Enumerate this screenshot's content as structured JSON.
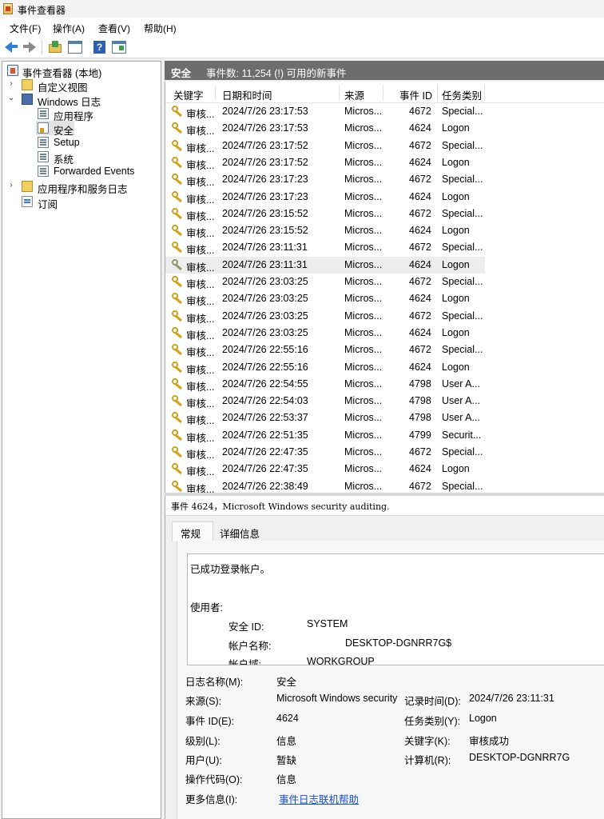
{
  "window": {
    "title": "事件查看器"
  },
  "menu": [
    "文件(F)",
    "操作(A)",
    "查看(V)",
    "帮助(H)"
  ],
  "tree": {
    "root": "事件查看器 (本地)",
    "custom_views": "自定义视图",
    "windows_logs": "Windows 日志",
    "logs": [
      "应用程序",
      "安全",
      "Setup",
      "系统",
      "Forwarded Events"
    ],
    "app_service_logs": "应用程序和服务日志",
    "subscriptions": "订阅"
  },
  "pane": {
    "title": "安全",
    "count_text": "事件数: 11,254 (!) 可用的新事件"
  },
  "columns": [
    "关键字",
    "日期和时间",
    "来源",
    "事件 ID",
    "任务类别"
  ],
  "rows": [
    [
      "审核...",
      "2024/7/26 23:17:53",
      "Micros...",
      "4672",
      "Special..."
    ],
    [
      "审核...",
      "2024/7/26 23:17:53",
      "Micros...",
      "4624",
      "Logon"
    ],
    [
      "审核...",
      "2024/7/26 23:17:52",
      "Micros...",
      "4672",
      "Special..."
    ],
    [
      "审核...",
      "2024/7/26 23:17:52",
      "Micros...",
      "4624",
      "Logon"
    ],
    [
      "审核...",
      "2024/7/26 23:17:23",
      "Micros...",
      "4672",
      "Special..."
    ],
    [
      "审核...",
      "2024/7/26 23:17:23",
      "Micros...",
      "4624",
      "Logon"
    ],
    [
      "审核...",
      "2024/7/26 23:15:52",
      "Micros...",
      "4672",
      "Special..."
    ],
    [
      "审核...",
      "2024/7/26 23:15:52",
      "Micros...",
      "4624",
      "Logon"
    ],
    [
      "审核...",
      "2024/7/26 23:11:31",
      "Micros...",
      "4672",
      "Special..."
    ],
    [
      "审核...",
      "2024/7/26 23:11:31",
      "Micros...",
      "4624",
      "Logon"
    ],
    [
      "审核...",
      "2024/7/26 23:03:25",
      "Micros...",
      "4672",
      "Special..."
    ],
    [
      "审核...",
      "2024/7/26 23:03:25",
      "Micros...",
      "4624",
      "Logon"
    ],
    [
      "审核...",
      "2024/7/26 23:03:25",
      "Micros...",
      "4672",
      "Special..."
    ],
    [
      "审核...",
      "2024/7/26 23:03:25",
      "Micros...",
      "4624",
      "Logon"
    ],
    [
      "审核...",
      "2024/7/26 22:55:16",
      "Micros...",
      "4672",
      "Special..."
    ],
    [
      "审核...",
      "2024/7/26 22:55:16",
      "Micros...",
      "4624",
      "Logon"
    ],
    [
      "审核...",
      "2024/7/26 22:54:55",
      "Micros...",
      "4798",
      "User A..."
    ],
    [
      "审核...",
      "2024/7/26 22:54:03",
      "Micros...",
      "4798",
      "User A..."
    ],
    [
      "审核...",
      "2024/7/26 22:53:37",
      "Micros...",
      "4798",
      "User A..."
    ],
    [
      "审核...",
      "2024/7/26 22:51:35",
      "Micros...",
      "4799",
      "Securit..."
    ],
    [
      "审核...",
      "2024/7/26 22:47:35",
      "Micros...",
      "4672",
      "Special..."
    ],
    [
      "审核...",
      "2024/7/26 22:47:35",
      "Micros...",
      "4624",
      "Logon"
    ],
    [
      "审核...",
      "2024/7/26 22:38:49",
      "Micros...",
      "4672",
      "Special..."
    ]
  ],
  "selected_row": 9,
  "detail": {
    "title": "事件 4624，Microsoft Windows security auditing.",
    "tabs": [
      "常规",
      "详细信息"
    ],
    "message": {
      "line1": "已成功登录帐户。",
      "subject": "使用者:",
      "sid_label": "安全 ID:",
      "sid_value": "SYSTEM",
      "account_label": "帐户名称:",
      "account_value": "DESKTOP-DGNRR7G$",
      "domain_label": "帐户域:",
      "domain_value": "WORKGROUP"
    },
    "props": {
      "log_name_label": "日志名称(M):",
      "log_name": "安全",
      "source_label": "来源(S):",
      "source": "Microsoft Windows security",
      "logged_label": "记录时间(D):",
      "logged": "2024/7/26 23:11:31",
      "event_id_label": "事件 ID(E):",
      "event_id": "4624",
      "task_label": "任务类别(Y):",
      "task": "Logon",
      "level_label": "级别(L):",
      "level": "信息",
      "keywords_label": "关键字(K):",
      "keywords": "审核成功",
      "user_label": "用户(U):",
      "user": "暂缺",
      "computer_label": "计算机(R):",
      "computer": "DESKTOP-DGNRR7G",
      "opcode_label": "操作代码(O):",
      "opcode": "信息",
      "more_label": "更多信息(I):",
      "more_link": "事件日志联机帮助"
    }
  }
}
